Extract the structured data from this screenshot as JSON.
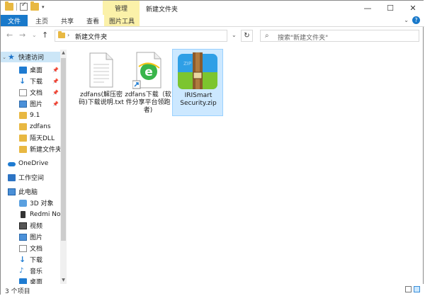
{
  "window": {
    "title": "新建文件夹",
    "context_tab": "管理",
    "controls": {
      "minimize": "—",
      "maximize": "☐",
      "close": "✕"
    }
  },
  "ribbon": {
    "tabs": [
      "文件",
      "主页",
      "共享",
      "查看",
      "图片工具"
    ],
    "collapse_icon": "⌄",
    "help_icon": "?"
  },
  "address": {
    "back": "←",
    "forward": "→",
    "recent": "⌄",
    "up": "↑",
    "path": "新建文件夹",
    "sep": "›",
    "dropdown": "⌄",
    "refresh": "↻"
  },
  "search": {
    "placeholder": "搜索\"新建文件夹\"",
    "icon": "⌕"
  },
  "sidebar": {
    "quick_access": "快速访问",
    "quick_items": [
      {
        "label": "桌面",
        "pinned": true
      },
      {
        "label": "下载",
        "pinned": true
      },
      {
        "label": "文档",
        "pinned": true
      },
      {
        "label": "图片",
        "pinned": true
      },
      {
        "label": "9.1",
        "pinned": false
      },
      {
        "label": "zdfans",
        "pinned": false
      },
      {
        "label": "陌天DLL",
        "pinned": false
      },
      {
        "label": "新建文件夹",
        "pinned": false
      }
    ],
    "onedrive": "OneDrive",
    "network": "工作空间",
    "this_pc": "此电脑",
    "pc_items": [
      "3D 对象",
      "Redmi Note",
      "视频",
      "图片",
      "文档",
      "下载",
      "音乐",
      "桌面"
    ]
  },
  "files": [
    {
      "name_line1": "zdfans(解压密",
      "name_line2": "码)下载说明.txt",
      "name_line3": "",
      "type": "txt",
      "selected": false
    },
    {
      "name_line1": "zdfans下载（软",
      "name_line2": "件分享平台领跑",
      "name_line3": "者)",
      "type": "url",
      "selected": false
    },
    {
      "name_line1": "IRISmart",
      "name_line2": "Security.zip",
      "name_line3": "",
      "type": "zip",
      "selected": true
    }
  ],
  "zip_icon_text": "ZIP",
  "status": {
    "count": "3 个项目"
  },
  "colors": {
    "accent": "#1979ca",
    "context_tab": "#fbf1a9",
    "selection": "#cce8ff"
  }
}
